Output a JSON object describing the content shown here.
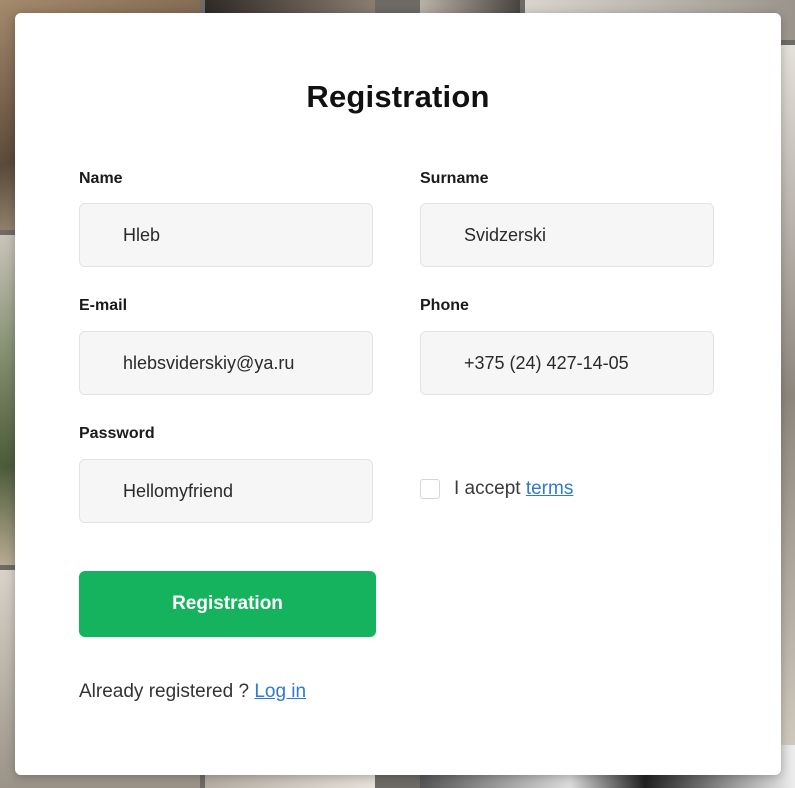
{
  "form": {
    "title": "Registration",
    "name": {
      "label": "Name",
      "value": "Hleb"
    },
    "surname": {
      "label": "Surname",
      "value": "Svidzerski"
    },
    "email": {
      "label": "E-mail",
      "value": "hlebsviderskiy@ya.ru"
    },
    "phone": {
      "label": "Phone",
      "value": "+375 (24) 427-14-05"
    },
    "password": {
      "label": "Password",
      "value": "Hellomyfriend"
    },
    "terms": {
      "text": "I accept",
      "link": "terms",
      "checked": false
    },
    "submit_label": "Registration",
    "footer": {
      "text": "Already registered ?",
      "link": "Log in"
    }
  },
  "colors": {
    "accent": "#16b35e",
    "link": "#2f78d6"
  }
}
